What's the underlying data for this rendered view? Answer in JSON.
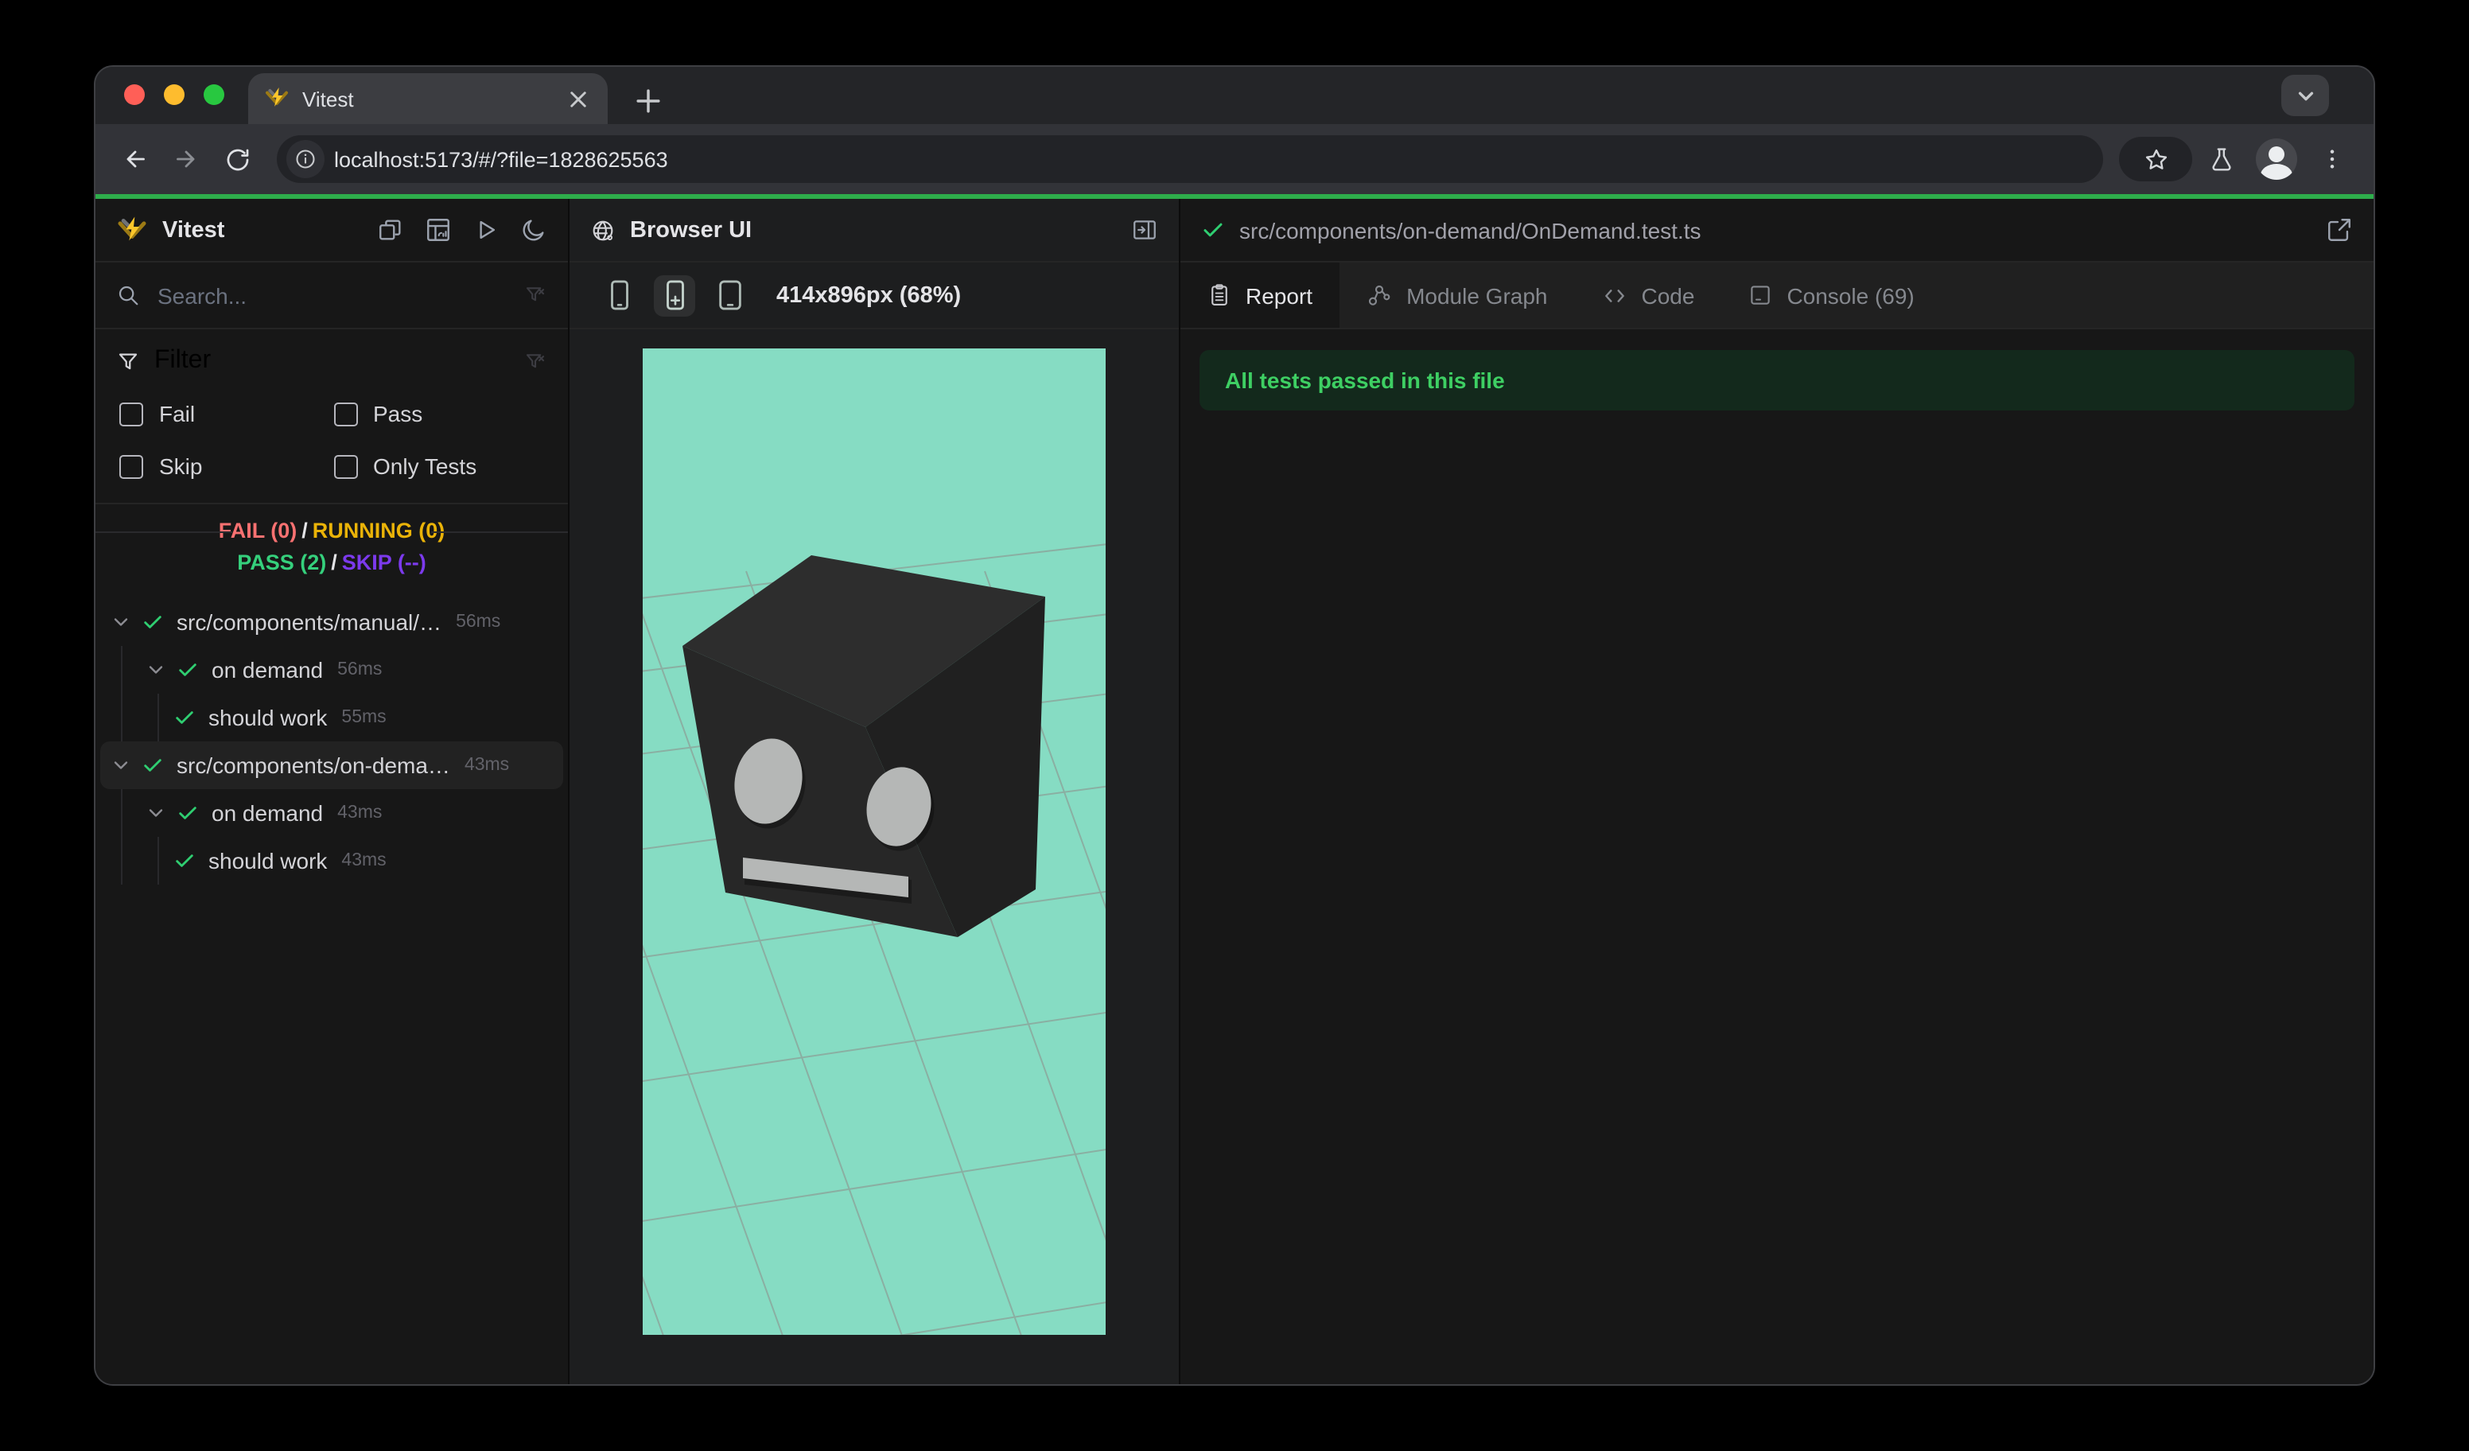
{
  "colors": {
    "accent_green": "#2ead4b",
    "viewport_bg": "#86dcc3",
    "grid_line": "#8c9c95",
    "fail": "#f87171",
    "running": "#eab308",
    "pass": "#35d07c",
    "skip": "#7c3aed",
    "check": "#2fce71",
    "banner_bg": "#13291c",
    "banner_text": "#3ecf63",
    "cube_top": "#2d2d2d",
    "cube_front": "#272727",
    "cube_side": "#202020",
    "cube_feature": "#b5b7b6",
    "vitest_yellow": "#fcc72b"
  },
  "browser": {
    "tab_title": "Vitest",
    "url": "localhost:5173/#/?file=1828625563"
  },
  "sidebar": {
    "title": "Vitest",
    "search_placeholder": "Search...",
    "filter": {
      "title": "Filter",
      "options": [
        "Fail",
        "Pass",
        "Skip",
        "Only Tests"
      ]
    },
    "summary": {
      "fail": "FAIL (0)",
      "running": "RUNNING (0)",
      "pass": "PASS (2)",
      "skip": "SKIP (--)",
      "separator": "/"
    },
    "tree": [
      {
        "label": "src/components/manual/…",
        "time": "56ms"
      },
      {
        "label": "on demand",
        "time": "56ms"
      },
      {
        "label": "should work",
        "time": "55ms"
      },
      {
        "label": "src/components/on-dema…",
        "time": "43ms"
      },
      {
        "label": "on demand",
        "time": "43ms"
      },
      {
        "label": "should work",
        "time": "43ms"
      }
    ]
  },
  "browser_panel": {
    "title": "Browser UI",
    "size_label": "414x896px (68%)"
  },
  "report_panel": {
    "file_path": "src/components/on-demand/OnDemand.test.ts",
    "tabs": [
      {
        "label": "Report"
      },
      {
        "label": "Module Graph"
      },
      {
        "label": "Code"
      },
      {
        "label": "Console (69)"
      }
    ],
    "banner": "All tests passed in this file"
  }
}
